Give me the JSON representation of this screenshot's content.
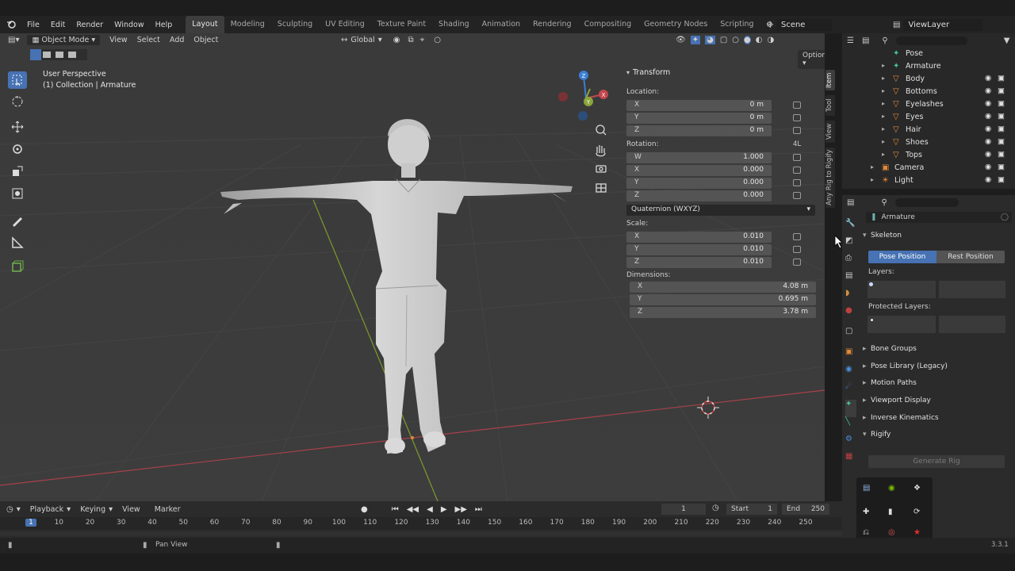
{
  "top_menu": {
    "items": [
      "File",
      "Edit",
      "Render",
      "Window",
      "Help"
    ],
    "workspaces": [
      "Layout",
      "Modeling",
      "Sculpting",
      "UV Editing",
      "Texture Paint",
      "Shading",
      "Animation",
      "Rendering",
      "Compositing",
      "Geometry Nodes",
      "Scripting"
    ],
    "active_workspace": "Layout",
    "scene_label": "Scene",
    "view_layer_label": "ViewLayer"
  },
  "viewport_header": {
    "mode": "Object Mode",
    "menus": [
      "View",
      "Select",
      "Add",
      "Object"
    ],
    "transform_orientation": "Global",
    "options_label": "Options"
  },
  "viewport": {
    "view_name": "User Perspective",
    "collection_info": "(1) Collection | Armature",
    "gizmo_axes": {
      "x": "X",
      "y": "Y",
      "z": "Z"
    }
  },
  "n_panel": {
    "title": "Transform",
    "location_label": "Location:",
    "location": [
      {
        "axis": "X",
        "value": "0 m"
      },
      {
        "axis": "Y",
        "value": "0 m"
      },
      {
        "axis": "Z",
        "value": "0 m"
      }
    ],
    "rotation_label": "Rotation:",
    "rotation_mode_badge": "4L",
    "rotation": [
      {
        "axis": "W",
        "value": "1.000"
      },
      {
        "axis": "X",
        "value": "0.000"
      },
      {
        "axis": "Y",
        "value": "0.000"
      },
      {
        "axis": "Z",
        "value": "0.000"
      }
    ],
    "rotation_mode": "Quaternion (WXYZ)",
    "scale_label": "Scale:",
    "scale": [
      {
        "axis": "X",
        "value": "0.010"
      },
      {
        "axis": "Y",
        "value": "0.010"
      },
      {
        "axis": "Z",
        "value": "0.010"
      }
    ],
    "dimensions_label": "Dimensions:",
    "dimensions": [
      {
        "axis": "X",
        "value": "4.08 m"
      },
      {
        "axis": "Y",
        "value": "0.695 m"
      },
      {
        "axis": "Z",
        "value": "3.78 m"
      }
    ],
    "tabs": [
      "Item",
      "Tool",
      "View",
      "Any Rig to Rigify"
    ]
  },
  "outliner": {
    "items": [
      {
        "name": "Pose",
        "indent": 2,
        "icon": "pose-icon"
      },
      {
        "name": "Armature",
        "indent": 2,
        "icon": "armature-icon"
      },
      {
        "name": "Body",
        "indent": 2,
        "icon": "mesh-icon"
      },
      {
        "name": "Bottoms",
        "indent": 2,
        "icon": "mesh-icon"
      },
      {
        "name": "Eyelashes",
        "indent": 2,
        "icon": "mesh-icon"
      },
      {
        "name": "Eyes",
        "indent": 2,
        "icon": "mesh-icon"
      },
      {
        "name": "Hair",
        "indent": 2,
        "icon": "mesh-icon"
      },
      {
        "name": "Shoes",
        "indent": 2,
        "icon": "mesh-icon"
      },
      {
        "name": "Tops",
        "indent": 2,
        "icon": "mesh-icon"
      },
      {
        "name": "Camera",
        "indent": 1,
        "icon": "camera-icon"
      },
      {
        "name": "Light",
        "indent": 1,
        "icon": "light-icon"
      }
    ]
  },
  "properties": {
    "object_name": "Armature",
    "skeleton_label": "Skeleton",
    "pose_position_label": "Pose Position",
    "rest_position_label": "Rest Position",
    "layers_label": "Layers:",
    "protected_layers_label": "Protected Layers:",
    "sections": [
      "Bone Groups",
      "Pose Library (Legacy)",
      "Motion Paths",
      "Viewport Display",
      "Inverse Kinematics"
    ],
    "rigify_label": "Rigify",
    "generate_rig_label": "Generate Rig"
  },
  "timeline": {
    "menus": [
      "Playback",
      "Keying",
      "View",
      "Marker"
    ],
    "current_frame": "1",
    "start_label": "Start",
    "start_value": "1",
    "end_label": "End",
    "end_value": "250",
    "ruler_ticks": [
      "1",
      "10",
      "20",
      "30",
      "40",
      "50",
      "60",
      "70",
      "80",
      "90",
      "100",
      "110",
      "120",
      "130",
      "140",
      "150",
      "160",
      "170",
      "180",
      "190",
      "200",
      "210",
      "220",
      "230",
      "240",
      "250"
    ]
  },
  "status_bar": {
    "hint": "Pan View",
    "version": "3.3.1"
  },
  "colors": {
    "accent": "#4772b3",
    "viewport_bg": "#3a3a3a",
    "x_axis": "#c4464d",
    "y_axis": "#8aa63a",
    "z_axis": "#3b7ed4"
  }
}
